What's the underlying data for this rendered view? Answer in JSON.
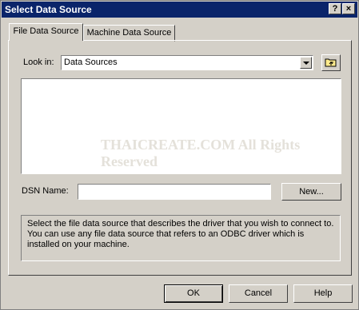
{
  "window": {
    "title": "Select Data Source",
    "help_btn": "?",
    "close_btn": "×"
  },
  "tabs": [
    {
      "label": "File Data Source"
    },
    {
      "label": "Machine Data Source"
    }
  ],
  "look_in": {
    "label": "Look in:",
    "value": "Data Sources"
  },
  "dsn": {
    "label": "DSN Name:",
    "value": ""
  },
  "new_button": "New...",
  "description": "Select the file data source that describes the driver that you wish to connect to. You can use any file data source that refers to an ODBC driver which is installed on your machine.",
  "buttons": {
    "ok": "OK",
    "cancel": "Cancel",
    "help": "Help"
  },
  "watermark": "THAICREATE.COM All Rights Reserved"
}
